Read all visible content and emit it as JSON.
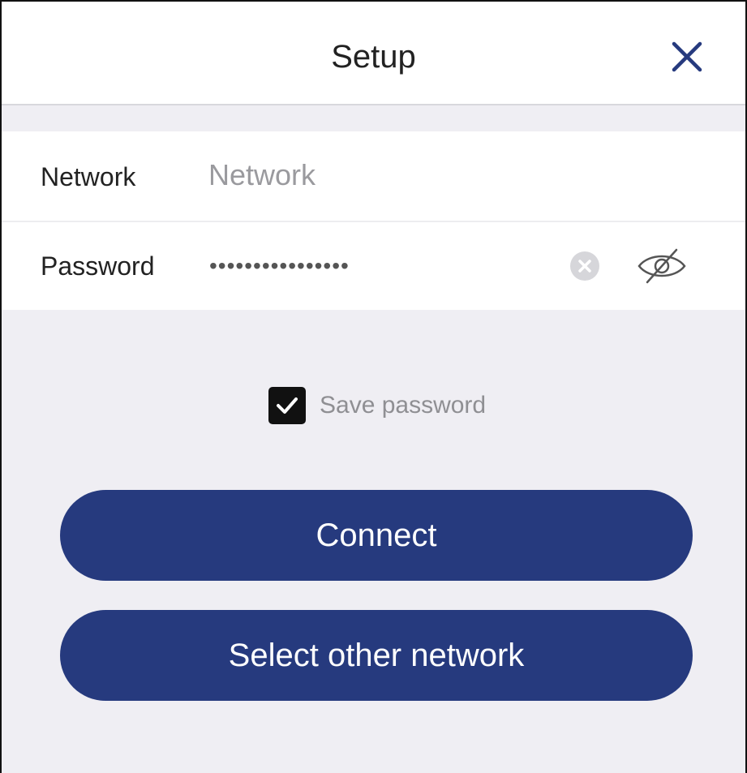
{
  "header": {
    "title": "Setup",
    "close_icon": "close-icon"
  },
  "form": {
    "network": {
      "label": "Network",
      "placeholder": "Network",
      "value": ""
    },
    "password": {
      "label": "Password",
      "masked_value": "••••••••••••••••",
      "clear_icon": "clear-circle-icon",
      "visibility_icon": "eye-slash-icon"
    }
  },
  "save_password": {
    "label": "Save password",
    "checked": true
  },
  "buttons": {
    "connect": "Connect",
    "select_other": "Select other network"
  },
  "colors": {
    "accent": "#263a7e",
    "background": "#efeef3"
  }
}
